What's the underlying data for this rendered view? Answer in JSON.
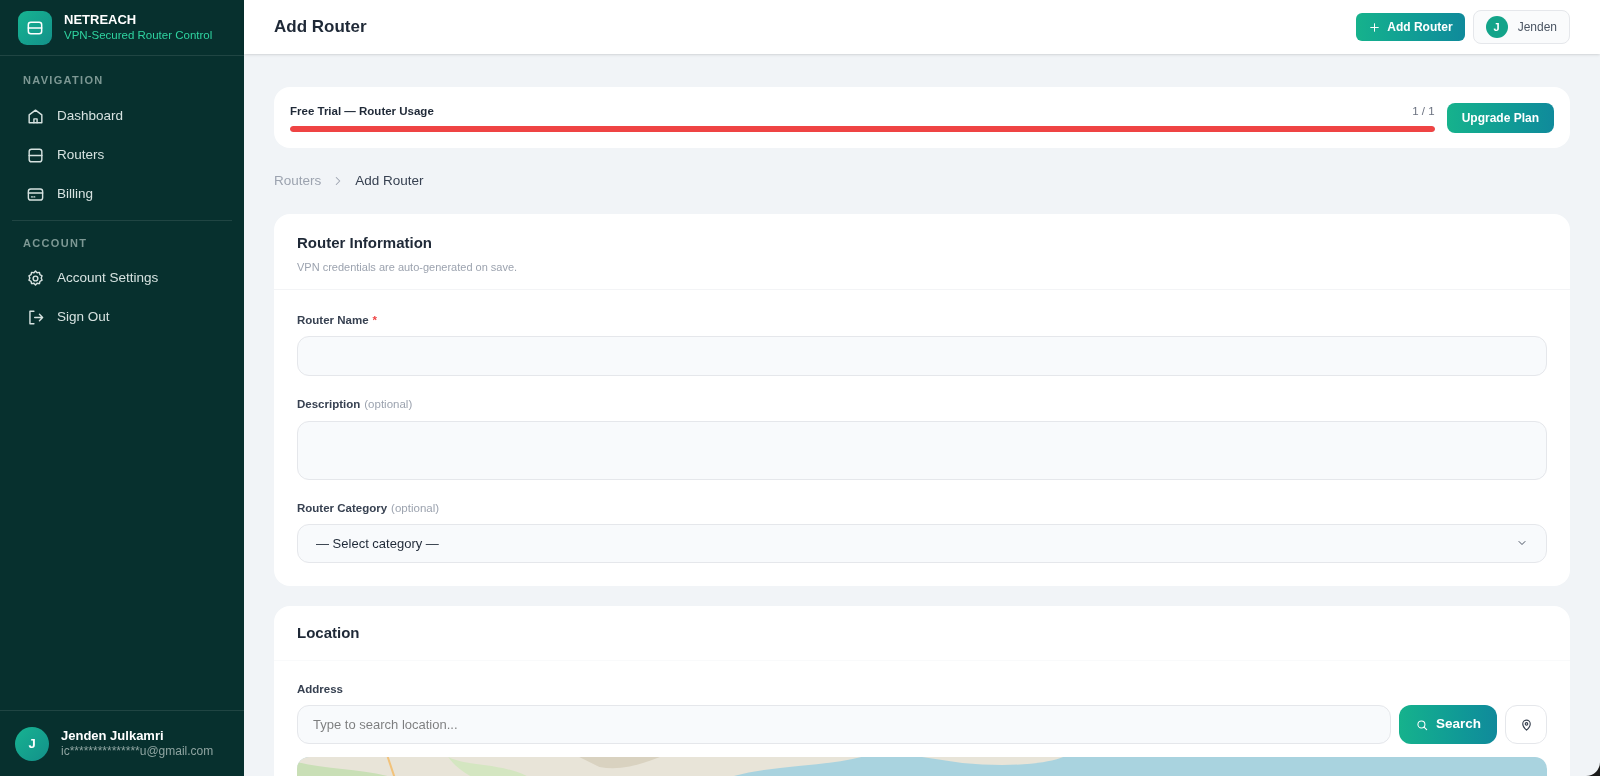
{
  "brand": {
    "name": "NETREACH",
    "tagline": "VPN-Secured Router Control"
  },
  "sidebar": {
    "sections": [
      {
        "heading": "NAVIGATION",
        "items": [
          {
            "label": "Dashboard",
            "selected": false
          },
          {
            "label": "Routers",
            "selected": false
          },
          {
            "label": "Billing",
            "selected": false
          }
        ]
      },
      {
        "heading": "ACCOUNT",
        "items": [
          {
            "label": "Account Settings",
            "selected": false
          },
          {
            "label": "Sign Out",
            "selected": false
          }
        ]
      }
    ],
    "user": {
      "initial": "J",
      "name": "Jenden Julkamri",
      "email": "ic***************u@gmail.com"
    }
  },
  "header": {
    "title": "Add Router",
    "add_button": "Add Router",
    "user": {
      "initial": "J",
      "name": "Jenden"
    }
  },
  "usage": {
    "label": "Free Trial — Router Usage",
    "count": "1 / 1",
    "level": 1,
    "button": "Upgrade Plan"
  },
  "breadcrumb": [
    "Routers",
    "Add Router"
  ],
  "router_info": {
    "title": "Router Information",
    "subtitle": "VPN credentials are auto-generated on save.",
    "fields": [
      {
        "kind": "input",
        "label": "Router Name",
        "required_mark": "*"
      },
      {
        "kind": "textarea",
        "label": "Description",
        "hint": "(optional)"
      },
      {
        "kind": "select",
        "label": "Router Category",
        "hint": "(optional)",
        "value": "— Select category —"
      }
    ]
  },
  "location": {
    "title": "Location",
    "address_label": "Address",
    "placeholder": "Type to search location...",
    "search_button": "Search"
  }
}
